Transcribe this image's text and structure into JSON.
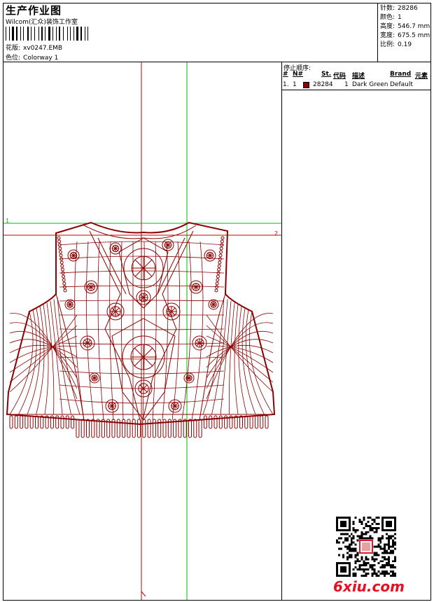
{
  "header": {
    "title": "生产作业图",
    "company": "Wilcom(汇众)装饰工作室",
    "pattern_label": "花版:",
    "pattern_value": "xv0247.EMB",
    "colorway_label": "色位:",
    "colorway_value": "Colorway 1"
  },
  "stats": {
    "stitches_label": "针数:",
    "stitches_value": "28286",
    "colors_label": "颜色:",
    "colors_value": "1",
    "height_label": "高度:",
    "height_value": "546.7 mm",
    "width_label": "宽度:",
    "width_value": "675.5 mm",
    "scale_label": "比例:",
    "scale_value": "0.19"
  },
  "stop_sequence": {
    "title": "停止顺序:",
    "columns": [
      "#",
      "N#",
      "St.",
      "代码",
      "描述",
      "Brand",
      "元素"
    ],
    "rows": [
      {
        "index": "1.",
        "needle": "1",
        "color": "#8b0000",
        "stitches": "28284",
        "code": "1",
        "description": "Dark Green",
        "brand": "Default"
      }
    ]
  },
  "design": {
    "thread_color": "#8b0000",
    "guide_red": "#cc0000",
    "guide_green": "#00bb00",
    "marker_left": "1",
    "marker_right": "2"
  },
  "watermark": "6xiu.com"
}
